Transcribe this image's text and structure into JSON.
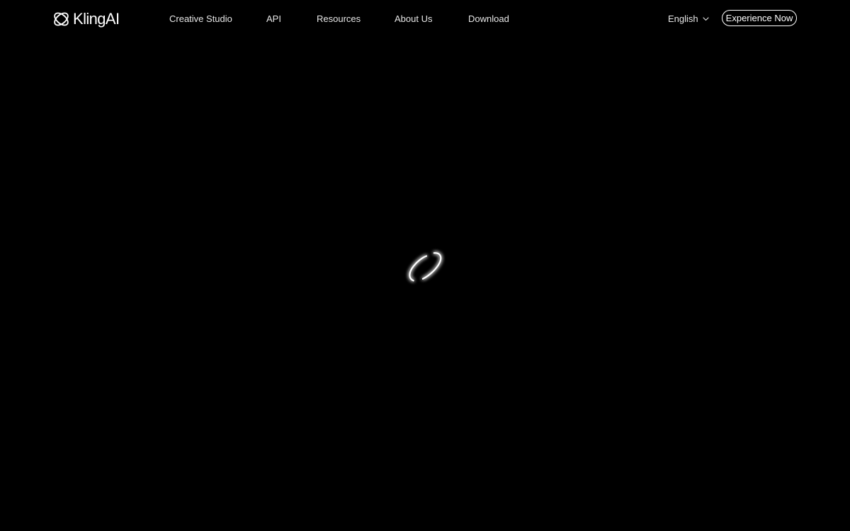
{
  "brand": {
    "name": "KlingAI",
    "logo_icon": "kling-logo-icon"
  },
  "nav": {
    "items": [
      {
        "label": "Creative Studio"
      },
      {
        "label": "API"
      },
      {
        "label": "Resources"
      },
      {
        "label": "About Us"
      },
      {
        "label": "Download"
      }
    ],
    "language": {
      "label": "English",
      "icon": "chevron-down-icon"
    },
    "cta_label": "Experience Now"
  },
  "main": {
    "loader_icon": "loading-ring-icon"
  },
  "colors": {
    "background": "#000000",
    "text": "#ffffff",
    "nav_text": "#e8e8e8",
    "loader_glow": "#ffffff"
  }
}
